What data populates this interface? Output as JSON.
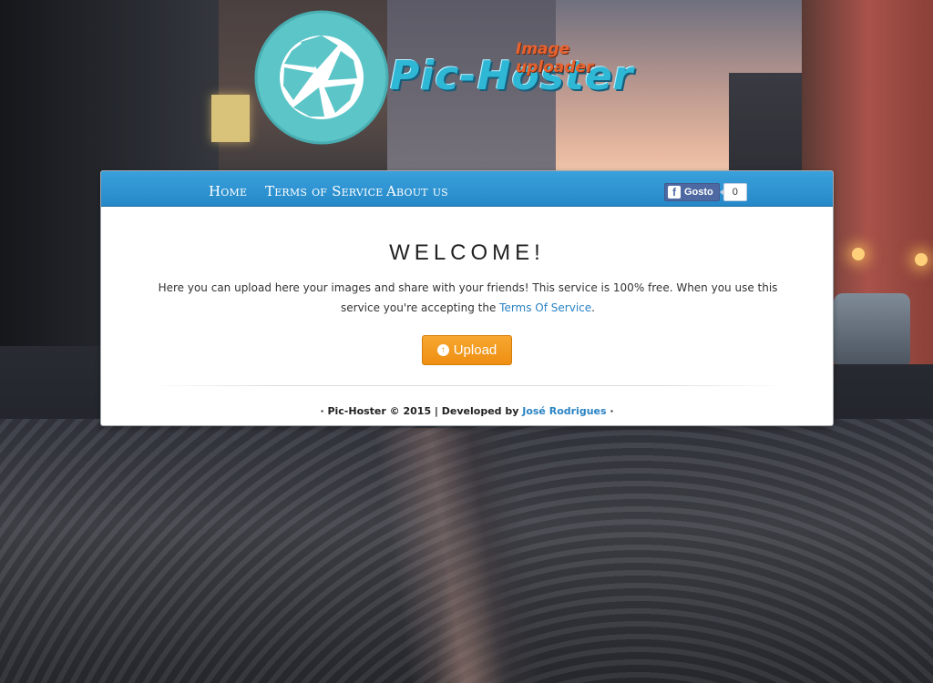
{
  "logo": {
    "title": "Pic-Hoster",
    "subtitle": "Image uploader",
    "colors": {
      "circle": "#5cc5c8",
      "title": "#2fb7d6",
      "subtitle": "#e8622e"
    }
  },
  "nav": {
    "items": [
      {
        "label": "Home"
      },
      {
        "label": "Terms of Service"
      },
      {
        "label": "About us"
      }
    ],
    "facebook": {
      "label": "Gosto",
      "count": "0",
      "icon": "facebook-icon"
    },
    "color": "#2f93d2"
  },
  "main": {
    "heading": "WELCOME!",
    "intro_text": "Here you can upload here your images and share with your friends! This service is 100% free. When you use this service you're accepting the ",
    "tos_link": "Terms Of Service",
    "intro_end": ".",
    "upload_button": "Upload",
    "upload_icon": "upload-circle-arrow-icon",
    "button_color": "#f29a1f"
  },
  "footer": {
    "prefix": "· Pic-Hoster © 2015 | Developed by ",
    "author": "José Rodrigues",
    "suffix": " ·"
  }
}
